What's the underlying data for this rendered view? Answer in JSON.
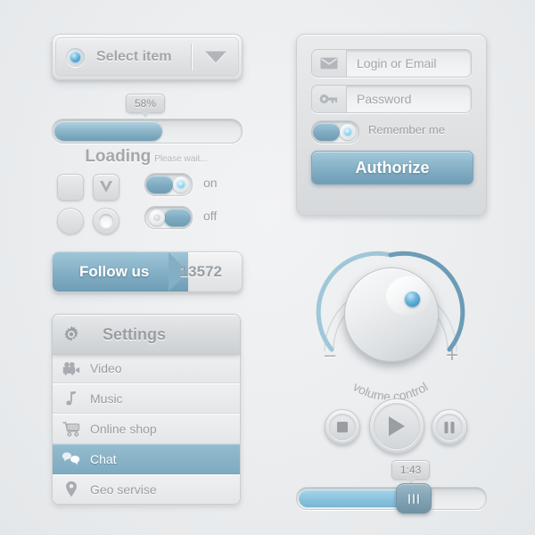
{
  "theme": {
    "accent_blue": "#7fa9bf",
    "accent_blue_light": "#9ec6d8",
    "text_grey": "#9a9ea2",
    "panel_grey": "#e4e6e8",
    "background": "#eceef0"
  },
  "select": {
    "label": "Select item",
    "led_icon": "led-indicator-icon",
    "arrow_icon": "chevron-down-icon"
  },
  "progress": {
    "percent_label": "58%",
    "percent_value": 58,
    "status": "Loading",
    "hint": "Please wait..."
  },
  "controls": {
    "checkbox_unchecked": "",
    "checkbox_checked_icon": "check-icon",
    "radio_unchecked": "",
    "radio_checked": "",
    "toggle_on_label": "on",
    "toggle_off_label": "off",
    "toggle_on_state": "on",
    "toggle_off_state": "off"
  },
  "follow": {
    "label": "Follow us",
    "count": "13572"
  },
  "settings": {
    "title": "Settings",
    "gear_icon": "gear-icon",
    "items": [
      {
        "label": "Video",
        "icon": "video-camera-icon",
        "active": false
      },
      {
        "label": "Music",
        "icon": "music-note-icon",
        "active": false
      },
      {
        "label": "Online shop",
        "icon": "shopping-cart-icon",
        "active": false
      },
      {
        "label": "Chat",
        "icon": "chat-bubbles-icon",
        "active": true
      },
      {
        "label": "Geo servise",
        "icon": "map-pin-icon",
        "active": false
      }
    ]
  },
  "login": {
    "email_placeholder": "Login or Email",
    "email_icon": "envelope-icon",
    "password_placeholder": "Password",
    "password_icon": "key-icon",
    "remember_label": "Remember me",
    "remember_state": "on",
    "authorize_label": "Authorize"
  },
  "volume": {
    "caption": "volume control",
    "minus_label": "–",
    "plus_label": "+",
    "minus_icon": "minus-icon",
    "plus_icon": "plus-icon",
    "indicator_icon": "knob-indicator-icon"
  },
  "player": {
    "stop_icon": "stop-icon",
    "play_icon": "play-icon",
    "pause_icon": "pause-icon"
  },
  "timebar": {
    "time_label": "1:43",
    "progress_percent": 62,
    "handle_icon": "slider-grip-icon"
  }
}
